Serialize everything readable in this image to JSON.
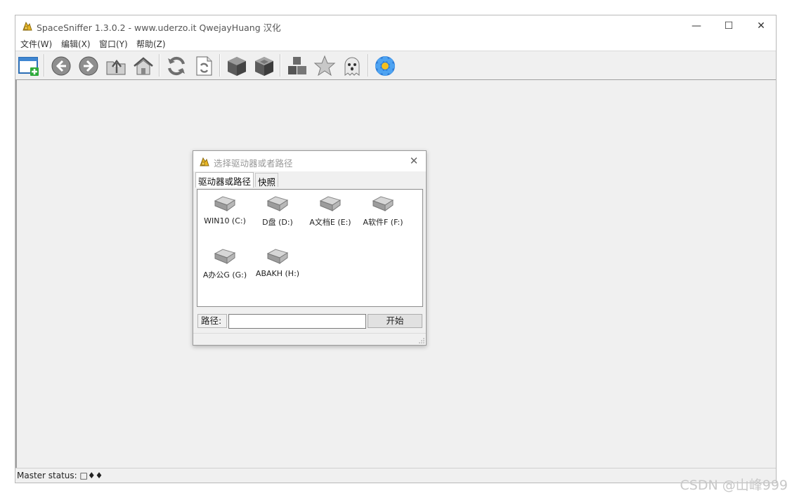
{
  "app": {
    "title": "SpaceSniffer 1.3.0.2 - www.uderzo.it  QwejayHuang 汉化",
    "window_controls": {
      "minimize": "—",
      "maximize": "☐",
      "close": "✕"
    }
  },
  "menu": [
    "文件(W)",
    "编辑(X)",
    "窗口(Y)",
    "帮助(Z)"
  ],
  "toolbar": {
    "buttons": [
      {
        "name": "new-window-icon"
      },
      {
        "name": "back-icon"
      },
      {
        "name": "forward-icon"
      },
      {
        "name": "up-folder-icon"
      },
      {
        "name": "home-icon"
      },
      {
        "name": "refresh-icon"
      },
      {
        "name": "refresh-document-icon"
      },
      {
        "name": "zoom-in-cube-icon"
      },
      {
        "name": "zoom-out-cube-icon"
      },
      {
        "name": "cubes-icon"
      },
      {
        "name": "star-icon"
      },
      {
        "name": "ghost-icon"
      },
      {
        "name": "flower-icon"
      }
    ]
  },
  "status": {
    "text": "Master status: □♦♦"
  },
  "dialog": {
    "title": "选择驱动器或者路径",
    "close": "✕",
    "tabs": [
      "驱动器或路径",
      "快照"
    ],
    "drives": [
      {
        "label": "WIN10 (C:)"
      },
      {
        "label": "D盘 (D:)"
      },
      {
        "label": "A文档E (E:)"
      },
      {
        "label": "A软件F (F:)"
      },
      {
        "label": "A办公G (G:)"
      },
      {
        "label": "ABAKH (H:)"
      }
    ],
    "path_label": "路径:",
    "path_value": "",
    "start_label": "开始"
  },
  "watermark": "CSDN @山峰999"
}
